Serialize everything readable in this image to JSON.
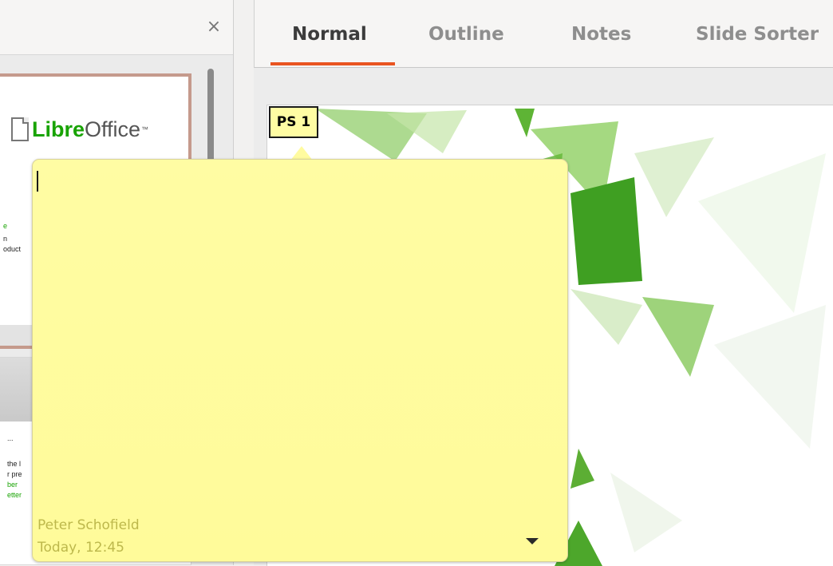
{
  "slide_pane": {
    "close_glyph": "×",
    "thumbnail_1": {
      "logo_word_bold": "Libre",
      "logo_word_regular": "Office",
      "logo_tm": "™",
      "text_fragments": [
        "e",
        "n",
        "oduct"
      ]
    },
    "thumbnail_2": {
      "text_fragments": [
        "...",
        "the l",
        "r pre",
        "ber",
        "etter"
      ]
    }
  },
  "view_tabs": {
    "normal": "Normal",
    "outline": "Outline",
    "notes": "Notes",
    "slide_sorter": "Slide Sorter",
    "active": "Normal"
  },
  "comment": {
    "marker_label": "PS 1",
    "text": "",
    "author": "Peter Schofield",
    "date": "Today, 12:45",
    "background_color": "#fffca3",
    "meta_text_color": "#bdb84c"
  },
  "colors": {
    "accent": "#e95420",
    "libreoffice_green": "#18a303"
  }
}
